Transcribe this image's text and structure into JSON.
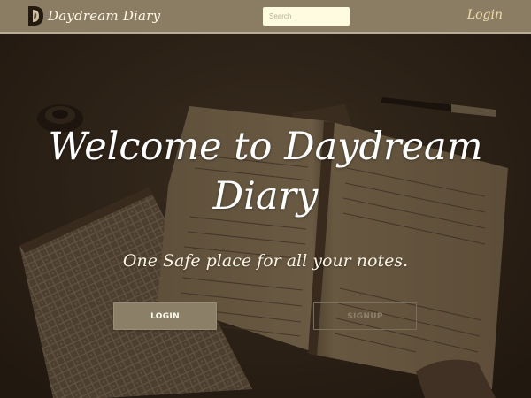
{
  "navbar": {
    "brand_name": "Daydream Diary",
    "logo_icon": "d-logo-icon",
    "search": {
      "placeholder": "Search",
      "value": ""
    },
    "login_label": "Login"
  },
  "hero": {
    "title": "Welcome to Daydream Diary",
    "subtitle": "One Safe place for all your notes.",
    "login_button": "LOGIN",
    "signup_button": "SIGNUP"
  },
  "colors": {
    "navbar": "#8a7d64",
    "search_bg": "#fffbe0",
    "login_link": "#f0dcaa",
    "button": "#8b8067",
    "background": "#2b2218"
  }
}
